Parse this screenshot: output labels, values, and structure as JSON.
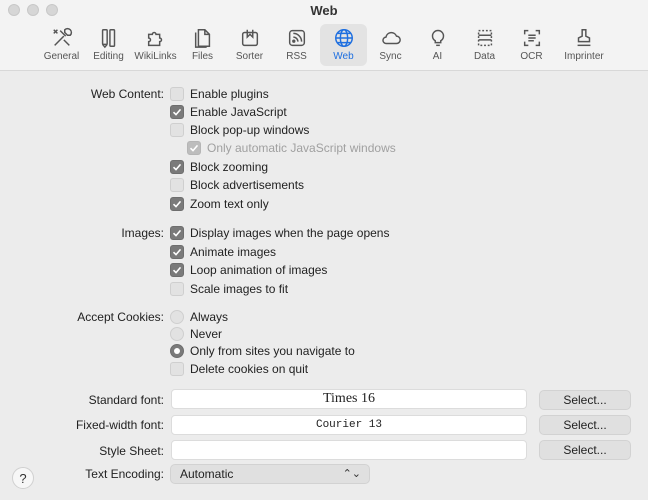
{
  "window": {
    "title": "Web"
  },
  "toolbar": {
    "items": [
      {
        "label": "General",
        "icon": "tools-icon"
      },
      {
        "label": "Editing",
        "icon": "pencil-icon"
      },
      {
        "label": "WikiLinks",
        "icon": "puzzle-icon"
      },
      {
        "label": "Files",
        "icon": "files-icon"
      },
      {
        "label": "Sorter",
        "icon": "sorter-icon"
      },
      {
        "label": "RSS",
        "icon": "rss-icon"
      },
      {
        "label": "Web",
        "icon": "globe-icon"
      },
      {
        "label": "Sync",
        "icon": "cloud-icon"
      },
      {
        "label": "AI",
        "icon": "lightbulb-icon"
      },
      {
        "label": "Data",
        "icon": "data-icon"
      },
      {
        "label": "OCR",
        "icon": "ocr-icon"
      },
      {
        "label": "Imprinter",
        "icon": "stamp-icon"
      }
    ],
    "active": "Web"
  },
  "web_content": {
    "label": "Web Content:",
    "options": [
      {
        "label": "Enable plugins",
        "checked": false
      },
      {
        "label": "Enable JavaScript",
        "checked": true
      },
      {
        "label": "Block pop-up windows",
        "checked": false
      },
      {
        "label": "Only automatic JavaScript windows",
        "checked": true,
        "disabled": true
      },
      {
        "label": "Block zooming",
        "checked": true
      },
      {
        "label": "Block advertisements",
        "checked": false
      },
      {
        "label": "Zoom text only",
        "checked": true
      }
    ]
  },
  "images": {
    "label": "Images:",
    "options": [
      {
        "label": "Display images when the page opens",
        "checked": true
      },
      {
        "label": "Animate images",
        "checked": true
      },
      {
        "label": "Loop animation of images",
        "checked": true
      },
      {
        "label": "Scale images to fit",
        "checked": false
      }
    ]
  },
  "cookies": {
    "label": "Accept Cookies:",
    "radios": [
      {
        "label": "Always",
        "selected": false
      },
      {
        "label": "Never",
        "selected": false
      },
      {
        "label": "Only from sites you navigate to",
        "selected": true
      }
    ],
    "delete_on_quit": {
      "label": "Delete cookies on quit",
      "checked": false
    }
  },
  "fonts": {
    "standard": {
      "label": "Standard font:",
      "value": "Times 16",
      "button": "Select..."
    },
    "fixed": {
      "label": "Fixed-width font:",
      "value": "Courier 13",
      "button": "Select..."
    },
    "stylesheet": {
      "label": "Style Sheet:",
      "value": "",
      "button": "Select..."
    }
  },
  "encoding": {
    "label": "Text Encoding:",
    "value": "Automatic"
  },
  "help": {
    "label": "?"
  }
}
